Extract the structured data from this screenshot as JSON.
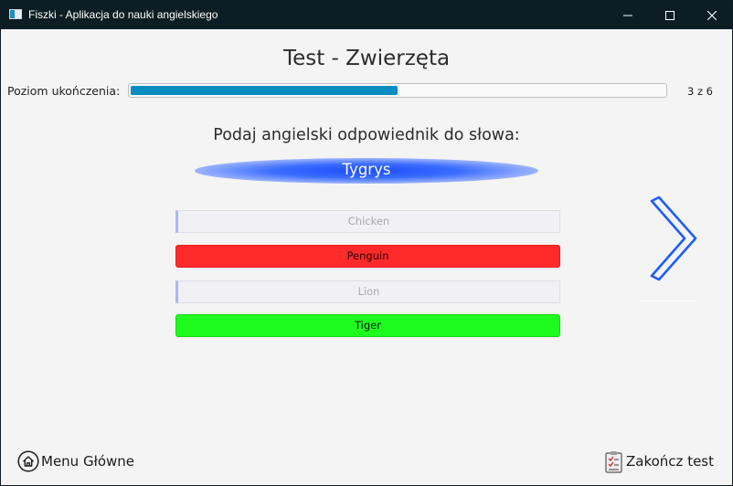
{
  "window": {
    "title": "Fiszki - Aplikacja do nauki angielskiego",
    "controls": {
      "minimize": "minimize-icon",
      "maximize": "maximize-icon",
      "close": "close-icon"
    }
  },
  "test": {
    "heading": "Test - Zwierzęta",
    "progress_label": "Poziom ukończenia:",
    "progress_fraction": 0.5,
    "progress_count": "3 z 6",
    "prompt": "Podaj angielski odpowiednik do słowa:",
    "word": "Tygrys",
    "answers": [
      {
        "label": "Chicken",
        "state": "neutral"
      },
      {
        "label": "Penguin",
        "state": "wrong"
      },
      {
        "label": "Lion",
        "state": "neutral"
      },
      {
        "label": "Tiger",
        "state": "correct"
      }
    ],
    "next_icon": "chevron-right-icon"
  },
  "footer": {
    "menu_label": "Menu Główne",
    "menu_icon": "home-icon",
    "finish_label": "Zakończ test",
    "finish_icon": "checklist-icon"
  },
  "colors": {
    "titlebar": "#0c1e23",
    "progress_fill": "#0a8dc0",
    "word_highlight": "#1c4dff",
    "wrong_answer": "#ff2a2a",
    "correct_answer": "#1ffb1f",
    "next_arrow": "#1d5cff"
  }
}
